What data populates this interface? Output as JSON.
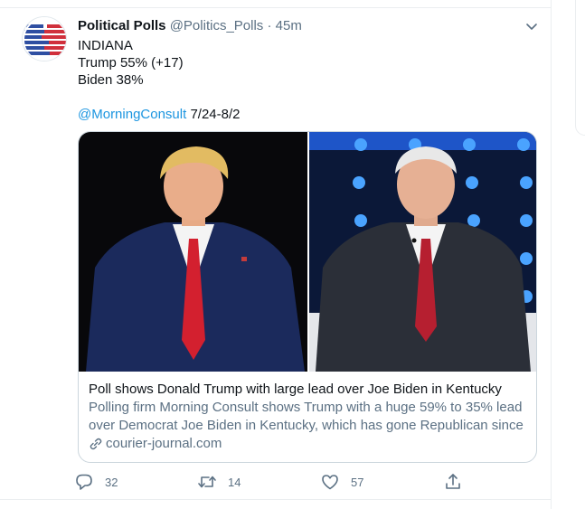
{
  "tweet": {
    "display_name": "Political Polls",
    "handle": "@Politics_Polls",
    "separator": "·",
    "time": "45m",
    "lines": [
      "INDIANA",
      "Trump 55% (+17)",
      "Biden 38%"
    ],
    "mention": "@MorningConsult",
    "date_range": " 7/24-8/2"
  },
  "card": {
    "title": "Poll shows Donald Trump with large lead over Joe Biden in Kentucky",
    "description": "Polling firm Morning Consult shows Trump with a huge 59% to 35% lead over Democrat Joe Biden in Kentucky, which has gone Republican since ...",
    "domain": "courier-journal.com"
  },
  "actions": {
    "reply_count": "32",
    "retweet_count": "14",
    "like_count": "57"
  },
  "colors": {
    "link": "#1b95e0",
    "secondary_text": "#5b7083",
    "border": "#ccd6dd",
    "avatar_red": "#d0303c",
    "avatar_blue": "#2f4fa2"
  },
  "icons": [
    "avatar-logo",
    "caret-down-icon",
    "link-icon",
    "reply-icon",
    "retweet-icon",
    "like-icon",
    "share-icon"
  ]
}
